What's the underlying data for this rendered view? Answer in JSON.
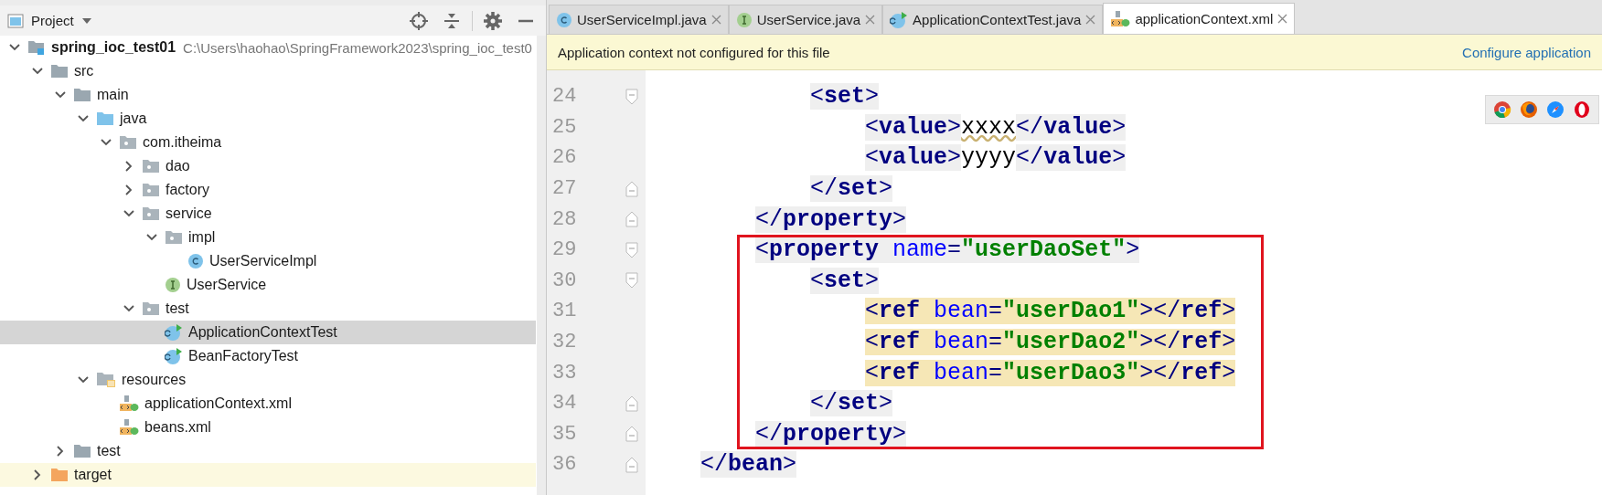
{
  "project_panel": {
    "title": "Project",
    "tree": [
      {
        "label": "spring_ioc_test01",
        "path": "C:\\Users\\haohao\\SpringFramework2023\\spring_ioc_test0",
        "kind": "module",
        "expanded": true,
        "selected": false,
        "excluded": false,
        "children": [
          {
            "label": "src",
            "kind": "folder",
            "expanded": true,
            "selected": false,
            "excluded": false,
            "children": [
              {
                "label": "main",
                "kind": "folder",
                "expanded": true,
                "selected": false,
                "excluded": false,
                "children": [
                  {
                    "label": "java",
                    "kind": "source",
                    "expanded": true,
                    "selected": false,
                    "excluded": false,
                    "children": [
                      {
                        "label": "com.itheima",
                        "kind": "package",
                        "expanded": true,
                        "selected": false,
                        "excluded": false,
                        "children": [
                          {
                            "label": "dao",
                            "kind": "package",
                            "expanded": false,
                            "selected": false,
                            "excluded": false
                          },
                          {
                            "label": "factory",
                            "kind": "package",
                            "expanded": false,
                            "selected": false,
                            "excluded": false
                          },
                          {
                            "label": "service",
                            "kind": "package",
                            "expanded": true,
                            "selected": false,
                            "excluded": false,
                            "children": [
                              {
                                "label": "impl",
                                "kind": "package",
                                "expanded": true,
                                "selected": false,
                                "excluded": false,
                                "children": [
                                  {
                                    "label": "UserServiceImpl",
                                    "kind": "class",
                                    "selected": false,
                                    "excluded": false
                                  }
                                ]
                              },
                              {
                                "label": "UserService",
                                "kind": "interface",
                                "selected": false,
                                "excluded": false
                              }
                            ]
                          },
                          {
                            "label": "test",
                            "kind": "package",
                            "expanded": true,
                            "selected": false,
                            "excluded": false,
                            "children": [
                              {
                                "label": "ApplicationContextTest",
                                "kind": "test",
                                "selected": true,
                                "excluded": false
                              },
                              {
                                "label": "BeanFactoryTest",
                                "kind": "test",
                                "selected": false,
                                "excluded": false
                              }
                            ]
                          }
                        ]
                      }
                    ]
                  },
                  {
                    "label": "resources",
                    "kind": "resources",
                    "expanded": true,
                    "selected": false,
                    "excluded": false,
                    "children": [
                      {
                        "label": "applicationContext.xml",
                        "kind": "xml",
                        "selected": false,
                        "excluded": false
                      },
                      {
                        "label": "beans.xml",
                        "kind": "xml",
                        "selected": false,
                        "excluded": false
                      }
                    ]
                  }
                ]
              },
              {
                "label": "test",
                "kind": "folder",
                "expanded": false,
                "selected": false,
                "excluded": false
              }
            ]
          },
          {
            "label": "target",
            "kind": "excluded",
            "expanded": false,
            "selected": false,
            "excluded": true
          }
        ]
      }
    ]
  },
  "editor": {
    "tabs": [
      {
        "label": "UserServiceImpl.java",
        "kind": "class",
        "selected": false
      },
      {
        "label": "UserService.java",
        "kind": "interface",
        "selected": false
      },
      {
        "label": "ApplicationContextTest.java",
        "kind": "test",
        "selected": false
      },
      {
        "label": "applicationContext.xml",
        "kind": "xml",
        "selected": true
      }
    ],
    "banner": {
      "message": "Application context not configured for this file",
      "link": "Configure application"
    },
    "lines": [
      {
        "number": "24",
        "fold_start": true,
        "fold_end": false,
        "highlighted": false,
        "framed": false,
        "segments": [
          {
            "kind": "tag",
            "tokens": [
              {
                "kind": "punct",
                "text": "            <"
              },
              {
                "kind": "tag",
                "text": "set"
              },
              {
                "kind": "punct",
                "text": ">"
              }
            ]
          }
        ]
      },
      {
        "number": "25",
        "fold_start": false,
        "fold_end": false,
        "highlighted": false,
        "framed": false,
        "segments": [
          {
            "kind": "tag",
            "tokens": [
              {
                "kind": "punct",
                "text": "                <"
              },
              {
                "kind": "tag",
                "text": "value"
              },
              {
                "kind": "punct",
                "text": ">"
              }
            ]
          },
          {
            "kind": "text",
            "text": "xxxx",
            "typo": true
          },
          {
            "kind": "tag",
            "tokens": [
              {
                "kind": "punct",
                "text": "</"
              },
              {
                "kind": "tag",
                "text": "value"
              },
              {
                "kind": "punct",
                "text": ">"
              }
            ]
          }
        ]
      },
      {
        "number": "26",
        "fold_start": false,
        "fold_end": false,
        "highlighted": false,
        "framed": false,
        "segments": [
          {
            "kind": "tag",
            "tokens": [
              {
                "kind": "punct",
                "text": "                <"
              },
              {
                "kind": "tag",
                "text": "value"
              },
              {
                "kind": "punct",
                "text": ">"
              }
            ]
          },
          {
            "kind": "text",
            "text": "yyyy",
            "typo": false
          },
          {
            "kind": "tag",
            "tokens": [
              {
                "kind": "punct",
                "text": "</"
              },
              {
                "kind": "tag",
                "text": "value"
              },
              {
                "kind": "punct",
                "text": ">"
              }
            ]
          }
        ]
      },
      {
        "number": "27",
        "fold_start": false,
        "fold_end": true,
        "highlighted": false,
        "framed": false,
        "segments": [
          {
            "kind": "tag",
            "tokens": [
              {
                "kind": "punct",
                "text": "            </"
              },
              {
                "kind": "tag",
                "text": "set"
              },
              {
                "kind": "punct",
                "text": ">"
              }
            ]
          }
        ]
      },
      {
        "number": "28",
        "fold_start": false,
        "fold_end": true,
        "highlighted": false,
        "framed": false,
        "segments": [
          {
            "kind": "tag",
            "tokens": [
              {
                "kind": "punct",
                "text": "        </"
              },
              {
                "kind": "tag",
                "text": "property"
              },
              {
                "kind": "punct",
                "text": ">"
              }
            ]
          }
        ]
      },
      {
        "number": "29",
        "fold_start": true,
        "fold_end": false,
        "highlighted": false,
        "framed": true,
        "segments": [
          {
            "kind": "tag",
            "tokens": [
              {
                "kind": "punct",
                "text": "        <"
              },
              {
                "kind": "tag",
                "text": "property"
              },
              {
                "kind": "attr",
                "text": " name"
              },
              {
                "kind": "punct",
                "text": "="
              },
              {
                "kind": "string",
                "text": "\"userDaoSet\""
              },
              {
                "kind": "punct",
                "text": ">"
              }
            ]
          }
        ]
      },
      {
        "number": "30",
        "fold_start": true,
        "fold_end": false,
        "highlighted": false,
        "framed": true,
        "segments": [
          {
            "kind": "tag",
            "tokens": [
              {
                "kind": "punct",
                "text": "            <"
              },
              {
                "kind": "tag",
                "text": "set"
              },
              {
                "kind": "punct",
                "text": ">"
              }
            ]
          }
        ]
      },
      {
        "number": "31",
        "fold_start": false,
        "fold_end": false,
        "highlighted": true,
        "framed": true,
        "segments": [
          {
            "kind": "tag",
            "tokens": [
              {
                "kind": "punct",
                "text": "                <"
              },
              {
                "kind": "tag",
                "text": "ref"
              },
              {
                "kind": "attr",
                "text": " bean"
              },
              {
                "kind": "punct",
                "text": "="
              },
              {
                "kind": "string",
                "text": "\"userDao1\""
              },
              {
                "kind": "punct",
                "text": "></"
              },
              {
                "kind": "tag",
                "text": "ref"
              },
              {
                "kind": "punct",
                "text": ">"
              }
            ]
          }
        ]
      },
      {
        "number": "32",
        "fold_start": false,
        "fold_end": false,
        "highlighted": true,
        "framed": true,
        "segments": [
          {
            "kind": "tag",
            "tokens": [
              {
                "kind": "punct",
                "text": "                <"
              },
              {
                "kind": "tag",
                "text": "ref"
              },
              {
                "kind": "attr",
                "text": " bean"
              },
              {
                "kind": "punct",
                "text": "="
              },
              {
                "kind": "string",
                "text": "\"userDao2\""
              },
              {
                "kind": "punct",
                "text": "></"
              },
              {
                "kind": "tag",
                "text": "ref"
              },
              {
                "kind": "punct",
                "text": ">"
              }
            ]
          }
        ]
      },
      {
        "number": "33",
        "fold_start": false,
        "fold_end": false,
        "highlighted": true,
        "framed": true,
        "segments": [
          {
            "kind": "tag",
            "tokens": [
              {
                "kind": "punct",
                "text": "                <"
              },
              {
                "kind": "tag",
                "text": "ref"
              },
              {
                "kind": "attr",
                "text": " bean"
              },
              {
                "kind": "punct",
                "text": "="
              },
              {
                "kind": "string",
                "text": "\"userDao3\""
              },
              {
                "kind": "punct",
                "text": "></"
              },
              {
                "kind": "tag",
                "text": "ref"
              },
              {
                "kind": "punct",
                "text": ">"
              }
            ]
          }
        ]
      },
      {
        "number": "34",
        "fold_start": false,
        "fold_end": true,
        "highlighted": false,
        "framed": true,
        "segments": [
          {
            "kind": "tag",
            "tokens": [
              {
                "kind": "punct",
                "text": "            </"
              },
              {
                "kind": "tag",
                "text": "set"
              },
              {
                "kind": "punct",
                "text": ">"
              }
            ]
          }
        ]
      },
      {
        "number": "35",
        "fold_start": false,
        "fold_end": true,
        "highlighted": false,
        "framed": true,
        "segments": [
          {
            "kind": "tag",
            "tokens": [
              {
                "kind": "punct",
                "text": "        </"
              },
              {
                "kind": "tag",
                "text": "property"
              },
              {
                "kind": "punct",
                "text": ">"
              }
            ]
          }
        ]
      },
      {
        "number": "36",
        "fold_start": false,
        "fold_end": true,
        "highlighted": false,
        "framed": false,
        "segments": [
          {
            "kind": "tag",
            "tokens": [
              {
                "kind": "punct",
                "text": "    </"
              },
              {
                "kind": "tag",
                "text": "bean"
              },
              {
                "kind": "punct",
                "text": ">"
              }
            ]
          }
        ]
      }
    ],
    "browser_toolbar": [
      {
        "kind": "chrome"
      },
      {
        "kind": "firefox"
      },
      {
        "kind": "safari"
      },
      {
        "kind": "opera"
      }
    ]
  }
}
